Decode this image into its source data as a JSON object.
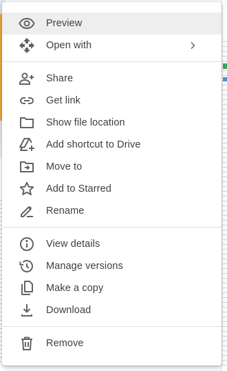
{
  "menu": {
    "colors": {
      "text": "#3c4043",
      "icon": "#5f6368",
      "hover": "#eeeeee",
      "divider": "#e0e0e0"
    },
    "groups": [
      [
        {
          "label": "Preview",
          "icon": "eye-icon",
          "active": true
        },
        {
          "label": "Open with",
          "icon": "open-with-icon",
          "submenu": true
        }
      ],
      [
        {
          "label": "Share",
          "icon": "add-person-icon"
        },
        {
          "label": "Get link",
          "icon": "link-icon"
        },
        {
          "label": "Show file location",
          "icon": "folder-icon"
        },
        {
          "label": "Add shortcut to Drive",
          "icon": "drive-shortcut-icon"
        },
        {
          "label": "Move to",
          "icon": "move-to-folder-icon"
        },
        {
          "label": "Add to Starred",
          "icon": "star-icon"
        },
        {
          "label": "Rename",
          "icon": "pencil-icon"
        }
      ],
      [
        {
          "label": "View details",
          "icon": "info-icon"
        },
        {
          "label": "Manage versions",
          "icon": "history-icon"
        },
        {
          "label": "Make a copy",
          "icon": "copy-icon"
        },
        {
          "label": "Download",
          "icon": "download-icon"
        }
      ],
      [
        {
          "label": "Remove",
          "icon": "trash-icon"
        }
      ]
    ]
  }
}
